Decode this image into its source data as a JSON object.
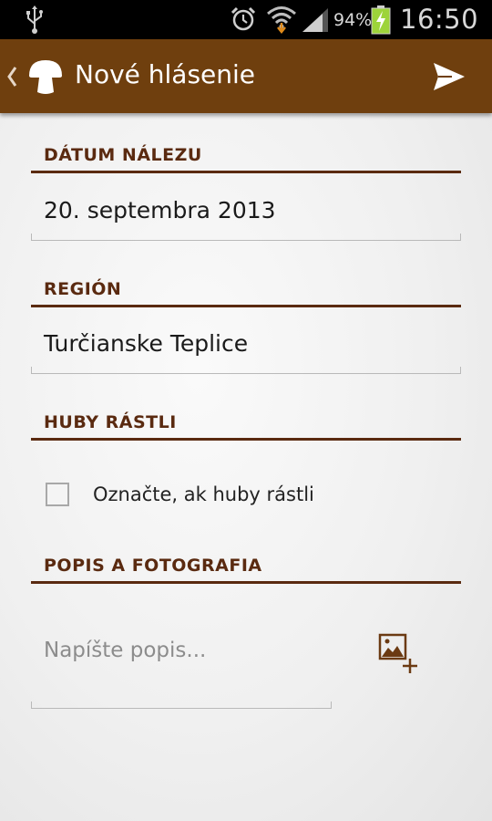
{
  "status_bar": {
    "battery_percent": "94%",
    "time": "16:50",
    "icons": [
      "usb-icon",
      "alarm-icon",
      "wifi-icon",
      "signal-icon",
      "battery-charging-icon"
    ]
  },
  "action_bar": {
    "title": "Nové hlásenie",
    "icons": [
      "up-caret-icon",
      "mushroom-logo-icon",
      "send-icon"
    ]
  },
  "form": {
    "date_section": {
      "label": "DÁTUM NÁLEZU",
      "value": "20. septembra 2013"
    },
    "region_section": {
      "label": "REGIÓN",
      "value": "Turčianske Teplice"
    },
    "growing_section": {
      "label": "HUBY RÁSTLI",
      "checkbox_label": "Označte, ak huby rástli",
      "checked": false
    },
    "description_section": {
      "label": "POPIS A FOTOGRAFIA",
      "placeholder": "Napíšte popis...",
      "photo_icon": "add-photo-icon"
    }
  },
  "colors": {
    "action_bar": "#6f3f0e",
    "section_header": "#5a2a10",
    "status_bar": "#000000"
  }
}
